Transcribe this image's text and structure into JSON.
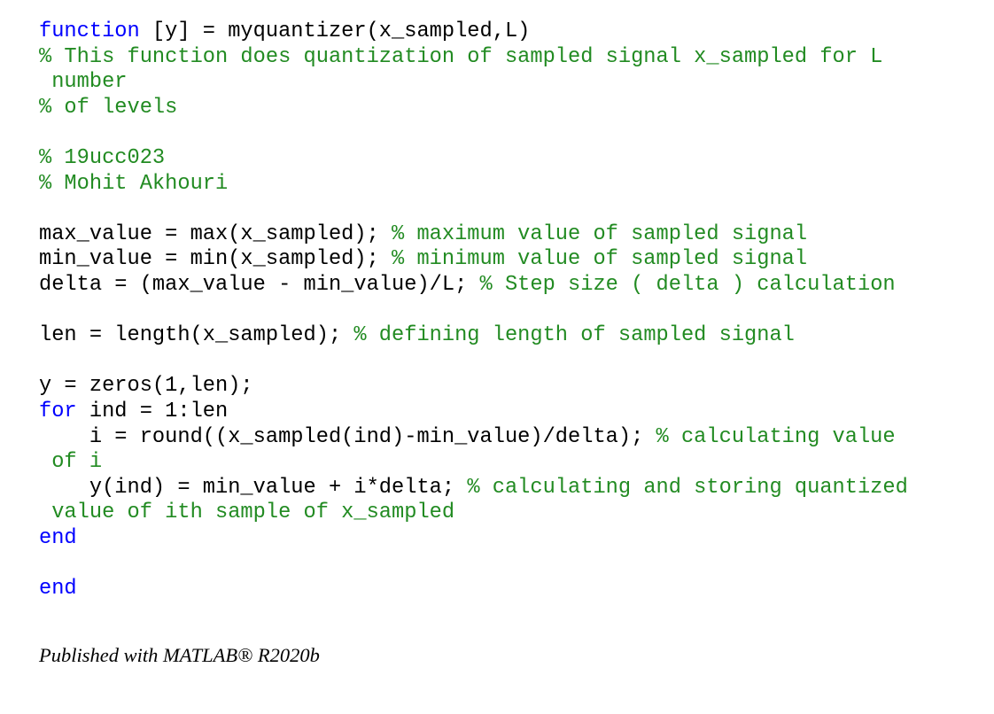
{
  "code_lines": [
    [
      {
        "t": "kw",
        "s": "function"
      },
      {
        "t": "tx",
        "s": " [y] = myquantizer(x_sampled,L)"
      }
    ],
    [
      {
        "t": "cm",
        "s": "% This function does quantization of sampled signal x_sampled for L"
      }
    ],
    [
      {
        "t": "cm",
        "s": " number"
      }
    ],
    [
      {
        "t": "cm",
        "s": "% of levels"
      }
    ],
    [],
    [
      {
        "t": "cm",
        "s": "% 19ucc023"
      }
    ],
    [
      {
        "t": "cm",
        "s": "% Mohit Akhouri"
      }
    ],
    [],
    [
      {
        "t": "tx",
        "s": "max_value = max(x_sampled); "
      },
      {
        "t": "cm",
        "s": "% maximum value of sampled signal"
      }
    ],
    [
      {
        "t": "tx",
        "s": "min_value = min(x_sampled); "
      },
      {
        "t": "cm",
        "s": "% minimum value of sampled signal"
      }
    ],
    [
      {
        "t": "tx",
        "s": "delta = (max_value - min_value)/L; "
      },
      {
        "t": "cm",
        "s": "% Step size ( delta ) calculation"
      }
    ],
    [],
    [
      {
        "t": "tx",
        "s": "len = length(x_sampled); "
      },
      {
        "t": "cm",
        "s": "% defining length of sampled signal"
      }
    ],
    [],
    [
      {
        "t": "tx",
        "s": "y = zeros(1,len);"
      }
    ],
    [
      {
        "t": "kw",
        "s": "for"
      },
      {
        "t": "tx",
        "s": " ind = 1:len"
      }
    ],
    [
      {
        "t": "tx",
        "s": "    i = round((x_sampled(ind)-min_value)/delta); "
      },
      {
        "t": "cm",
        "s": "% calculating value"
      }
    ],
    [
      {
        "t": "cm",
        "s": " of i"
      }
    ],
    [
      {
        "t": "tx",
        "s": "    y(ind) = min_value + i*delta; "
      },
      {
        "t": "cm",
        "s": "% calculating and storing quantized"
      }
    ],
    [
      {
        "t": "cm",
        "s": " value of ith sample of x_sampled"
      }
    ],
    [
      {
        "t": "kw",
        "s": "end"
      }
    ],
    [],
    [
      {
        "t": "kw",
        "s": "end"
      }
    ]
  ],
  "colors": {
    "keyword": "#0000ff",
    "comment": "#228b22",
    "text": "#000000"
  },
  "footer": {
    "text": "Published with MATLAB® R2020b"
  }
}
